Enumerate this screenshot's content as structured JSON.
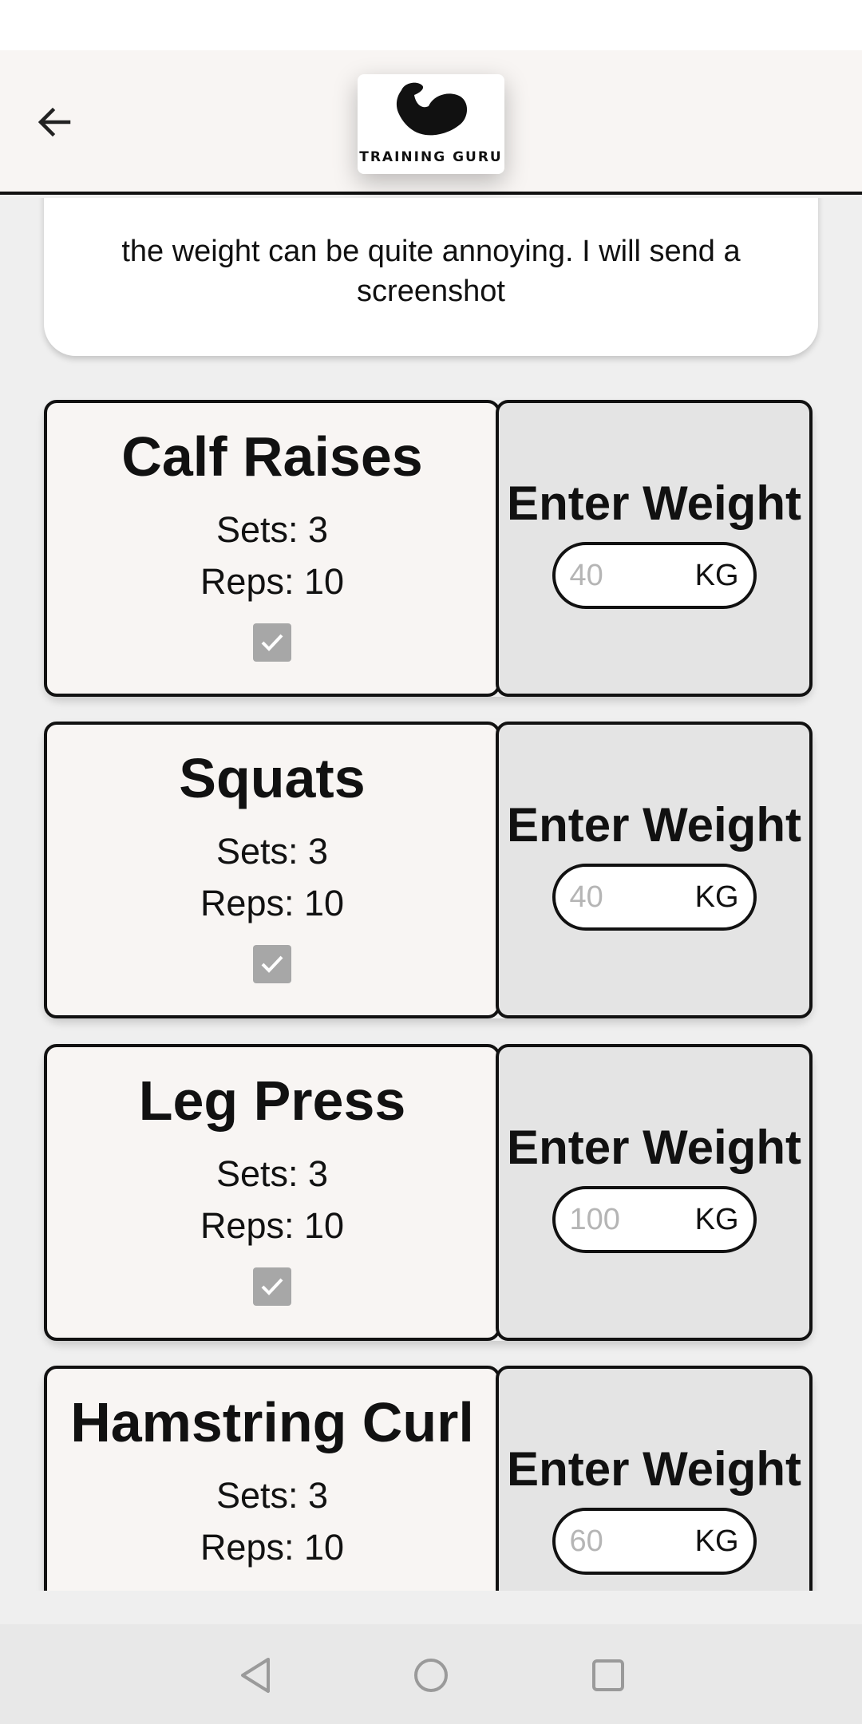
{
  "header": {
    "back_icon": "arrow-left-icon",
    "logo_icon": "flexed-bicep-icon",
    "logo_text": "TRAINING GURU"
  },
  "note": {
    "text": "the weight can be quite annoying. I will send a screenshot"
  },
  "exercises": [
    {
      "name": "Calf Raises",
      "sets": "Sets: 3",
      "reps": "Reps: 10",
      "completed": true,
      "weight_label": "Enter Weight",
      "weight_placeholder": "40",
      "unit": "KG"
    },
    {
      "name": "Squats",
      "sets": "Sets: 3",
      "reps": "Reps: 10",
      "completed": true,
      "weight_label": "Enter Weight",
      "weight_placeholder": "40",
      "unit": "KG"
    },
    {
      "name": "Leg Press",
      "sets": "Sets: 3",
      "reps": "Reps: 10",
      "completed": true,
      "weight_label": "Enter Weight",
      "weight_placeholder": "100",
      "unit": "KG"
    },
    {
      "name": "Hamstring Curl",
      "sets": "Sets: 3",
      "reps": "Reps: 10",
      "completed": false,
      "weight_label": "Enter Weight",
      "weight_placeholder": "60",
      "unit": "KG"
    }
  ],
  "nav": {
    "back_icon": "triangle-back-icon",
    "home_icon": "circle-home-icon",
    "recents_icon": "square-recents-icon"
  },
  "colors": {
    "app_bar": "#f8f5f3",
    "background": "#efefef",
    "weight_panel": "#e4e4e4",
    "checkbox": "#a7a7a7",
    "border": "#111111"
  }
}
